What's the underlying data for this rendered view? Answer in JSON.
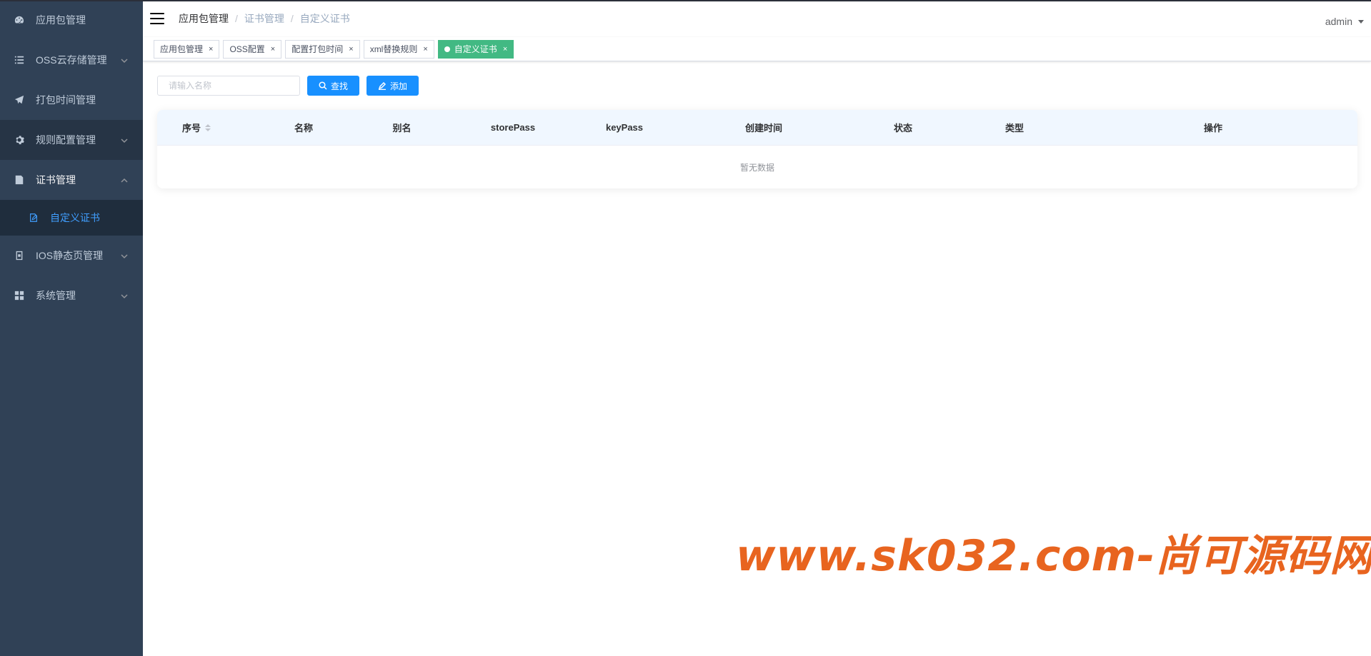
{
  "sidebar": {
    "items": [
      {
        "label": "应用包管理",
        "icon": "dashboard-icon"
      },
      {
        "label": "OSS云存储管理",
        "icon": "list-icon"
      },
      {
        "label": "打包时间管理",
        "icon": "send-icon"
      },
      {
        "label": "规则配置管理",
        "icon": "gear-icon"
      },
      {
        "label": "证书管理",
        "icon": "certificate-icon"
      },
      {
        "label": "IOS静态页管理",
        "icon": "page-icon"
      },
      {
        "label": "系统管理",
        "icon": "grid-icon"
      }
    ],
    "submenu": {
      "label": "自定义证书",
      "icon": "edit-doc-icon"
    }
  },
  "navbar": {
    "breadcrumb": [
      "应用包管理",
      "证书管理",
      "自定义证书"
    ],
    "separator": "/",
    "user": "admin"
  },
  "tags": [
    {
      "label": "应用包管理",
      "close": "×"
    },
    {
      "label": "OSS配置",
      "close": "×"
    },
    {
      "label": "配置打包时间",
      "close": "×"
    },
    {
      "label": "xml替换规则",
      "close": "×"
    },
    {
      "label": "自定义证书",
      "close": "×"
    }
  ],
  "toolbar": {
    "search_placeholder": "请输入名称",
    "search_label": "查找",
    "add_label": "添加"
  },
  "table": {
    "columns": [
      "序号",
      "名称",
      "别名",
      "storePass",
      "keyPass",
      "创建时间",
      "状态",
      "类型",
      "操作"
    ],
    "empty_text": "暂无数据"
  },
  "watermark": "www.sk032.com-尚可源码网",
  "colors": {
    "sidebar_bg": "#304156",
    "active_tag": "#42b983",
    "primary": "#1890ff",
    "watermark": "#e8641f"
  }
}
